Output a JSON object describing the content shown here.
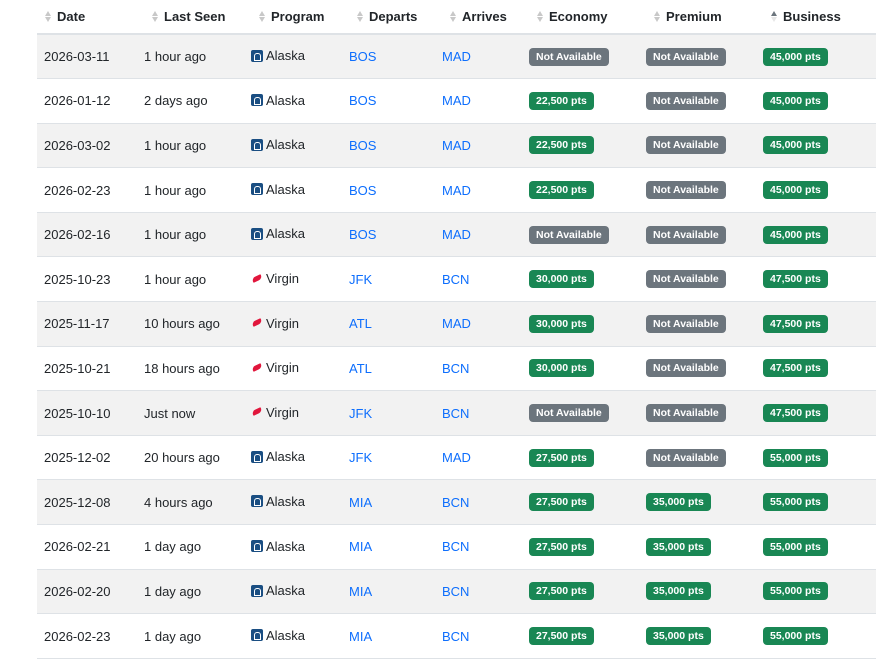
{
  "columns": [
    {
      "key": "date",
      "label": "Date",
      "sort": "none"
    },
    {
      "key": "last_seen",
      "label": "Last Seen",
      "sort": "none"
    },
    {
      "key": "program",
      "label": "Program",
      "sort": "none"
    },
    {
      "key": "departs",
      "label": "Departs",
      "sort": "none"
    },
    {
      "key": "arrives",
      "label": "Arrives",
      "sort": "none"
    },
    {
      "key": "economy",
      "label": "Economy",
      "sort": "none"
    },
    {
      "key": "premium",
      "label": "Premium",
      "sort": "none"
    },
    {
      "key": "business",
      "label": "Business",
      "sort": "asc"
    }
  ],
  "colors": {
    "available_badge": "#198754",
    "unavailable_badge": "#6c757d",
    "link": "#0d6efd",
    "alaska_icon": "#1a4e82",
    "virgin_icon": "#e1163c"
  },
  "rows": [
    {
      "date": "2026-03-11",
      "last_seen": "1 hour ago",
      "program": "Alaska",
      "program_icon": "alaska-logo-icon",
      "departs": "BOS",
      "arrives": "MAD",
      "economy": "Not Available",
      "premium": "Not Available",
      "business": "45,000 pts"
    },
    {
      "date": "2026-01-12",
      "last_seen": "2 days ago",
      "program": "Alaska",
      "program_icon": "alaska-logo-icon",
      "departs": "BOS",
      "arrives": "MAD",
      "economy": "22,500 pts",
      "premium": "Not Available",
      "business": "45,000 pts"
    },
    {
      "date": "2026-03-02",
      "last_seen": "1 hour ago",
      "program": "Alaska",
      "program_icon": "alaska-logo-icon",
      "departs": "BOS",
      "arrives": "MAD",
      "economy": "22,500 pts",
      "premium": "Not Available",
      "business": "45,000 pts"
    },
    {
      "date": "2026-02-23",
      "last_seen": "1 hour ago",
      "program": "Alaska",
      "program_icon": "alaska-logo-icon",
      "departs": "BOS",
      "arrives": "MAD",
      "economy": "22,500 pts",
      "premium": "Not Available",
      "business": "45,000 pts"
    },
    {
      "date": "2026-02-16",
      "last_seen": "1 hour ago",
      "program": "Alaska",
      "program_icon": "alaska-logo-icon",
      "departs": "BOS",
      "arrives": "MAD",
      "economy": "Not Available",
      "premium": "Not Available",
      "business": "45,000 pts"
    },
    {
      "date": "2025-10-23",
      "last_seen": "1 hour ago",
      "program": "Virgin",
      "program_icon": "virgin-logo-icon",
      "departs": "JFK",
      "arrives": "BCN",
      "economy": "30,000 pts",
      "premium": "Not Available",
      "business": "47,500 pts"
    },
    {
      "date": "2025-11-17",
      "last_seen": "10 hours ago",
      "program": "Virgin",
      "program_icon": "virgin-logo-icon",
      "departs": "ATL",
      "arrives": "MAD",
      "economy": "30,000 pts",
      "premium": "Not Available",
      "business": "47,500 pts"
    },
    {
      "date": "2025-10-21",
      "last_seen": "18 hours ago",
      "program": "Virgin",
      "program_icon": "virgin-logo-icon",
      "departs": "ATL",
      "arrives": "BCN",
      "economy": "30,000 pts",
      "premium": "Not Available",
      "business": "47,500 pts"
    },
    {
      "date": "2025-10-10",
      "last_seen": "Just now",
      "program": "Virgin",
      "program_icon": "virgin-logo-icon",
      "departs": "JFK",
      "arrives": "BCN",
      "economy": "Not Available",
      "premium": "Not Available",
      "business": "47,500 pts"
    },
    {
      "date": "2025-12-02",
      "last_seen": "20 hours ago",
      "program": "Alaska",
      "program_icon": "alaska-logo-icon",
      "departs": "JFK",
      "arrives": "MAD",
      "economy": "27,500 pts",
      "premium": "Not Available",
      "business": "55,000 pts"
    },
    {
      "date": "2025-12-08",
      "last_seen": "4 hours ago",
      "program": "Alaska",
      "program_icon": "alaska-logo-icon",
      "departs": "MIA",
      "arrives": "BCN",
      "economy": "27,500 pts",
      "premium": "35,000 pts",
      "business": "55,000 pts"
    },
    {
      "date": "2026-02-21",
      "last_seen": "1 day ago",
      "program": "Alaska",
      "program_icon": "alaska-logo-icon",
      "departs": "MIA",
      "arrives": "BCN",
      "economy": "27,500 pts",
      "premium": "35,000 pts",
      "business": "55,000 pts"
    },
    {
      "date": "2026-02-20",
      "last_seen": "1 day ago",
      "program": "Alaska",
      "program_icon": "alaska-logo-icon",
      "departs": "MIA",
      "arrives": "BCN",
      "economy": "27,500 pts",
      "premium": "35,000 pts",
      "business": "55,000 pts"
    },
    {
      "date": "2026-02-23",
      "last_seen": "1 day ago",
      "program": "Alaska",
      "program_icon": "alaska-logo-icon",
      "departs": "MIA",
      "arrives": "BCN",
      "economy": "27,500 pts",
      "premium": "35,000 pts",
      "business": "55,000 pts"
    }
  ]
}
